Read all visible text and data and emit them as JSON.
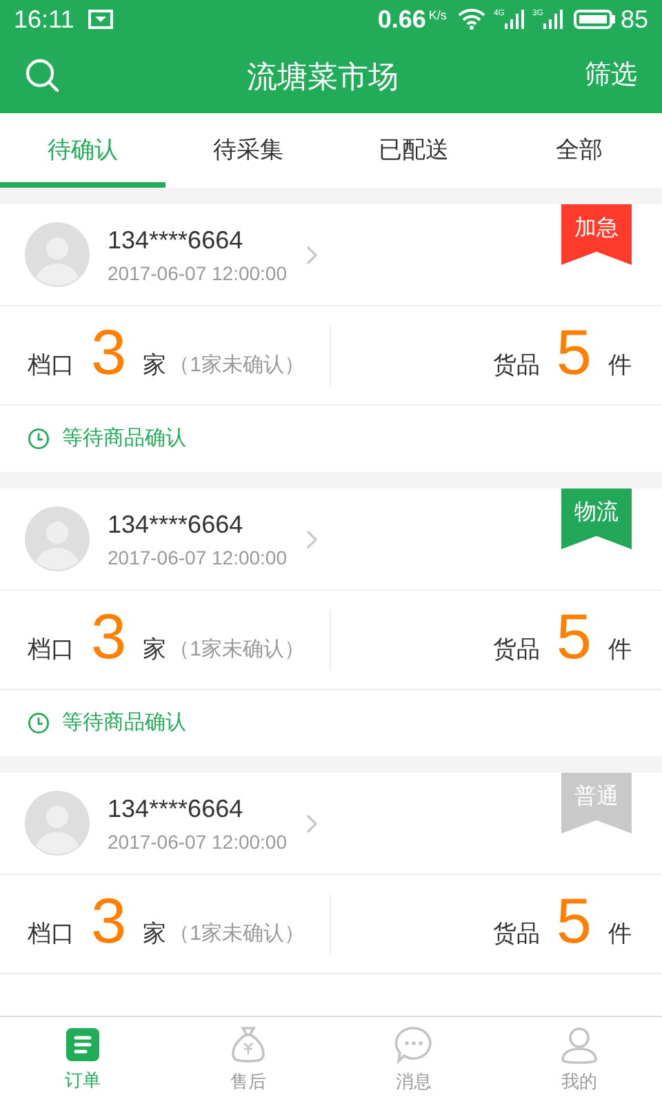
{
  "status_bar": {
    "time": "16:11",
    "speed": "0.66",
    "speed_unit": "K/s",
    "network_1": "4G",
    "network_2": "3G",
    "battery": "85"
  },
  "header": {
    "title": "流塘菜市场",
    "action": "筛选"
  },
  "tabs": [
    {
      "label": "待确认",
      "selected": true
    },
    {
      "label": "待采集",
      "selected": false
    },
    {
      "label": "已配送",
      "selected": false
    },
    {
      "label": "全部",
      "selected": false
    }
  ],
  "orders": [
    {
      "phone": "134****6664",
      "time": "2017-06-07 12:00:00",
      "tag": {
        "text": "加急",
        "color": "#ff3b2b"
      },
      "stall_label": "档口",
      "stall_count": "3",
      "stall_unit": "家",
      "stall_note": "（1家未确认）",
      "goods_label": "货品",
      "goods_count": "5",
      "goods_unit": "件",
      "status": "等待商品确认"
    },
    {
      "phone": "134****6664",
      "time": "2017-06-07 12:00:00",
      "tag": {
        "text": "物流",
        "color": "#22a858"
      },
      "stall_label": "档口",
      "stall_count": "3",
      "stall_unit": "家",
      "stall_note": "（1家未确认）",
      "goods_label": "货品",
      "goods_count": "5",
      "goods_unit": "件",
      "status": "等待商品确认"
    },
    {
      "phone": "134****6664",
      "time": "2017-06-07 12:00:00",
      "tag": {
        "text": "普通",
        "color": "#c9c9c9"
      },
      "stall_label": "档口",
      "stall_count": "3",
      "stall_unit": "家",
      "stall_note": "（1家未确认）",
      "goods_label": "货品",
      "goods_count": "5",
      "goods_unit": "件"
    }
  ],
  "bottom_nav": [
    {
      "label": "订单",
      "kind": "orders",
      "selected": true
    },
    {
      "label": "售后",
      "kind": "aftersale",
      "selected": false
    },
    {
      "label": "消息",
      "kind": "messages",
      "selected": false
    },
    {
      "label": "我的",
      "kind": "profile",
      "selected": false
    }
  ]
}
